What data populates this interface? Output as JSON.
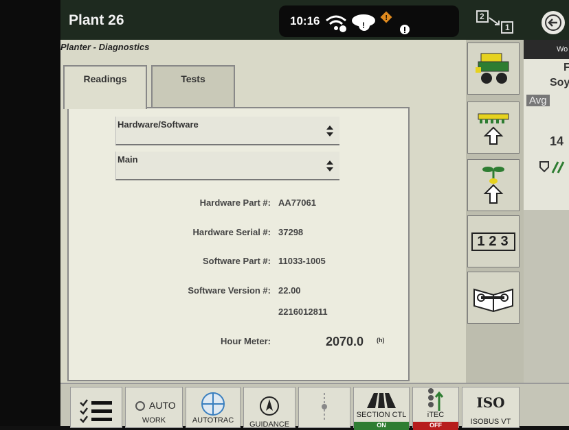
{
  "header": {
    "title": "Plant 26",
    "clock": "10:16"
  },
  "page_switch": {
    "from": "2",
    "to": "1"
  },
  "breadcrumb": "Planter - Diagnostics",
  "tabs": [
    {
      "label": "Readings",
      "active": true
    },
    {
      "label": "Tests",
      "active": false
    }
  ],
  "selects": {
    "category": "Hardware/Software",
    "module": "Main"
  },
  "readings": {
    "hardware_part_label": "Hardware Part #:",
    "hardware_part_value": "AA77061",
    "hardware_serial_label": "Hardware Serial #:",
    "hardware_serial_value": "37298",
    "software_part_label": "Software Part #:",
    "software_part_value": "11033-1005",
    "software_version_label": "Software Version #:",
    "software_version_value": "22.00",
    "software_version_extra": "2216012811",
    "hour_meter_label": "Hour Meter:",
    "hour_meter_value": "2070.0",
    "hour_meter_unit": "(h)"
  },
  "side_panel": {
    "top": "Wo",
    "line1": "F",
    "line2": "Soy",
    "avg": "Avg",
    "value": "14"
  },
  "right_buttons": {
    "number_label": "123"
  },
  "bottom_bar": {
    "auto_label": "AUTO",
    "work_label": "WORK",
    "autotrac_label": "AUTOTRAC",
    "guidance_label": "GUIDANCE",
    "section_ctl_label": "SECTION CTL",
    "section_state": "ON",
    "itec_label": "iTEC",
    "itec_state": "OFF",
    "iso_label": "ISO",
    "isobus_label": "ISOBUS VT"
  },
  "colors": {
    "topbar": "#1e2a1f",
    "panel": "#ececdf",
    "on_green": "#2e7d32",
    "off_red": "#b71c1c",
    "warning": "#e08a1e"
  }
}
